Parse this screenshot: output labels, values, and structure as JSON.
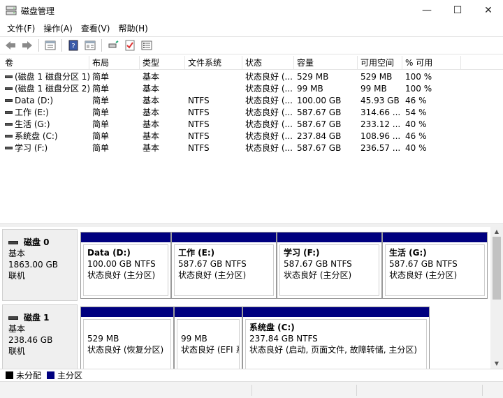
{
  "window": {
    "title": "磁盘管理",
    "minimize": "—",
    "maximize": "☐",
    "close": "✕"
  },
  "menu": [
    "文件(F)",
    "操作(A)",
    "查看(V)",
    "帮助(H)"
  ],
  "toolbar": {
    "icons": [
      "back-arrow-icon",
      "forward-arrow-icon",
      "properties-icon",
      "help-icon",
      "view-icon",
      "connect-icon",
      "check-icon",
      "list-icon"
    ]
  },
  "volume_list": {
    "columns": [
      "卷",
      "布局",
      "类型",
      "文件系统",
      "状态",
      "容量",
      "可用空间",
      "% 可用"
    ],
    "rows": [
      {
        "vol": "(磁盘 1 磁盘分区 1)",
        "layout": "简单",
        "type": "基本",
        "fs": "",
        "status": "状态良好 (...",
        "cap": "529 MB",
        "free": "529 MB",
        "pct": "100 %"
      },
      {
        "vol": "(磁盘 1 磁盘分区 2)",
        "layout": "简单",
        "type": "基本",
        "fs": "",
        "status": "状态良好 (...",
        "cap": "99 MB",
        "free": "99 MB",
        "pct": "100 %"
      },
      {
        "vol": "Data (D:)",
        "layout": "简单",
        "type": "基本",
        "fs": "NTFS",
        "status": "状态良好 (...",
        "cap": "100.00 GB",
        "free": "45.93 GB",
        "pct": "46 %"
      },
      {
        "vol": "工作 (E:)",
        "layout": "简单",
        "type": "基本",
        "fs": "NTFS",
        "status": "状态良好 (...",
        "cap": "587.67 GB",
        "free": "314.66 ...",
        "pct": "54 %"
      },
      {
        "vol": "生活 (G:)",
        "layout": "简单",
        "type": "基本",
        "fs": "NTFS",
        "status": "状态良好 (...",
        "cap": "587.67 GB",
        "free": "233.12 ...",
        "pct": "40 %"
      },
      {
        "vol": "系统盘 (C:)",
        "layout": "简单",
        "type": "基本",
        "fs": "NTFS",
        "status": "状态良好 (...",
        "cap": "237.84 GB",
        "free": "108.96 ...",
        "pct": "46 %"
      },
      {
        "vol": "学习 (F:)",
        "layout": "简单",
        "type": "基本",
        "fs": "NTFS",
        "status": "状态良好 (...",
        "cap": "587.67 GB",
        "free": "236.57 ...",
        "pct": "40 %"
      }
    ]
  },
  "disks": [
    {
      "name": "磁盘 0",
      "type": "基本",
      "size": "1863.00 GB",
      "state": "联机",
      "partitions": [
        {
          "name": "Data  (D:)",
          "size": "100.00 GB NTFS",
          "status": "状态良好 (主分区)"
        },
        {
          "name": "工作  (E:)",
          "size": "587.67 GB NTFS",
          "status": "状态良好 (主分区)"
        },
        {
          "name": "学习  (F:)",
          "size": "587.67 GB NTFS",
          "status": "状态良好 (主分区)"
        },
        {
          "name": "生活  (G:)",
          "size": "587.67 GB NTFS",
          "status": "状态良好 (主分区)"
        }
      ]
    },
    {
      "name": "磁盘 1",
      "type": "基本",
      "size": "238.46 GB",
      "state": "联机",
      "partitions": [
        {
          "name": "",
          "size": "529 MB",
          "status": "状态良好 (恢复分区)"
        },
        {
          "name": "",
          "size": "99 MB",
          "status": "状态良好 (EFI 系"
        },
        {
          "name": "系统盘  (C:)",
          "size": "237.84 GB NTFS",
          "status": "状态良好 (启动, 页面文件, 故障转储, 主分区)"
        }
      ]
    }
  ],
  "legend": [
    {
      "label": "未分配",
      "color": "#000000"
    },
    {
      "label": "主分区",
      "color": "#00007f"
    }
  ],
  "colors": {
    "partition_bar": "#00007f",
    "unallocated": "#000000"
  }
}
